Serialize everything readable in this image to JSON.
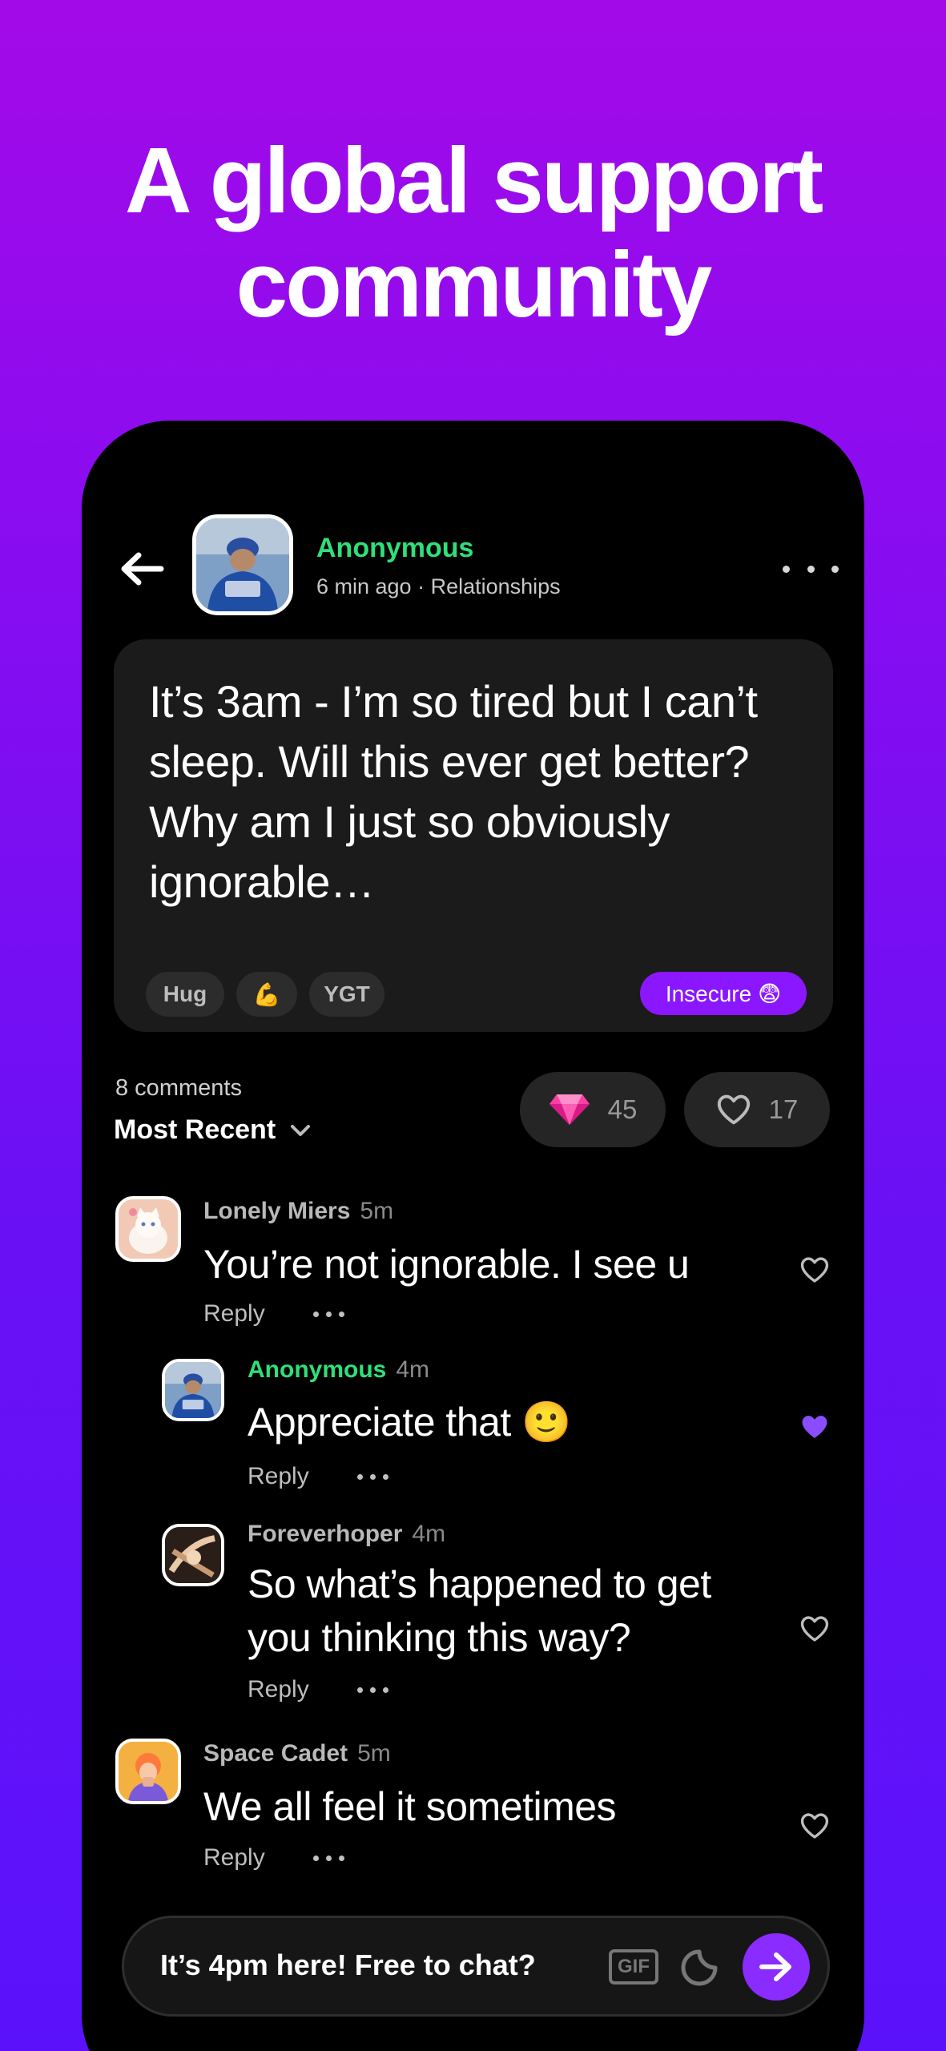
{
  "headline": {
    "line1": "A global support",
    "line2": "community"
  },
  "post": {
    "author": "Anonymous",
    "time": "6 min ago",
    "category": "Relationships",
    "text": "It’s 3am - I’m so tired but I can’t sleep. Will this ever get better? Why am I just so obviously ignorable…",
    "reactions": [
      {
        "label": "Hug"
      },
      {
        "label": "💪"
      },
      {
        "label": "YGT"
      }
    ],
    "mood_tag": "Insecure 😨"
  },
  "stats": {
    "comment_count": "8 comments",
    "sort_label": "Most Recent",
    "gems": "45",
    "likes": "17"
  },
  "comments": [
    {
      "name": "Lonely Miers",
      "time": "5m",
      "text": "You’re not ignorable. I see u",
      "reply": "Reply",
      "liked": false
    },
    {
      "name": "Anonymous",
      "time": "4m",
      "text": "Appreciate that 🙂",
      "reply": "Reply",
      "liked": true
    },
    {
      "name": "Foreverhoper",
      "time": "4m",
      "text": "So what’s happened to get you thinking this way?",
      "reply": "Reply",
      "liked": false
    },
    {
      "name": "Space Cadet",
      "time": "5m",
      "text": "We all feel it sometimes",
      "reply": "Reply",
      "liked": false
    }
  ],
  "composer": {
    "value": "It’s 4pm here! Free to chat?",
    "gif_label": "GIF"
  },
  "colors": {
    "accent_purple": "#8a17ff",
    "author_green": "#2fe07a",
    "liked_heart": "#8a4dff"
  }
}
